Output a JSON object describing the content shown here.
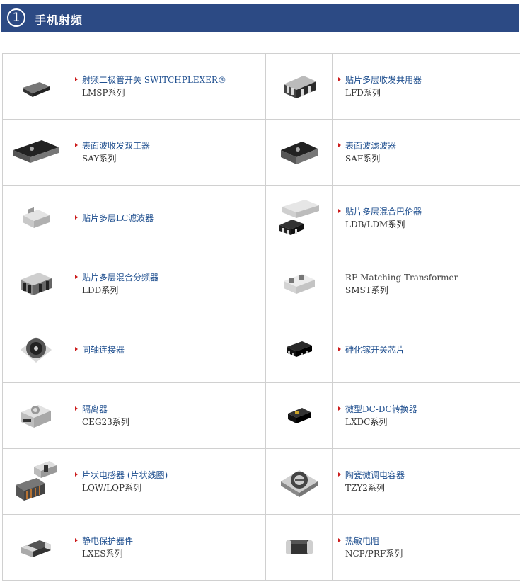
{
  "header": {
    "number": "1",
    "title": "手机射频"
  },
  "products": [
    {
      "icon": "chip-icon",
      "name": "射频二极管开关 SWITCHPLEXER®",
      "series": "LMSP系列",
      "link": true
    },
    {
      "icon": "chip-icon",
      "name": "贴片多层收发共用器",
      "series": "LFD系列",
      "link": true
    },
    {
      "icon": "saw-chip-icon",
      "name": "表面波收发双工器",
      "series": "SAY系列",
      "link": true
    },
    {
      "icon": "saw-chip-icon",
      "name": "表面波滤波器",
      "series": "SAF系列",
      "link": true
    },
    {
      "icon": "chip-icon",
      "name": "贴片多层LC滤波器",
      "series": "",
      "link": true
    },
    {
      "icon": "chip-icon",
      "name": "贴片多层混合巴伦器",
      "series": "LDB/LDM系列",
      "link": true
    },
    {
      "icon": "chip-icon",
      "name": "贴片多层混合分频器",
      "series": "LDD系列",
      "link": true
    },
    {
      "icon": "chip-icon",
      "name": "RF Matching Transformer",
      "series": "SMST系列",
      "link": false
    },
    {
      "icon": "connector-icon",
      "name": "同轴连接器",
      "series": "",
      "link": true
    },
    {
      "icon": "chip-icon",
      "name": "砷化镓开关芯片",
      "series": "",
      "link": true
    },
    {
      "icon": "isolator-icon",
      "name": "隔离器",
      "series": "CEG23系列",
      "link": true
    },
    {
      "icon": "chip-icon",
      "name": "微型DC-DC转换器",
      "series": "LXDC系列",
      "link": true
    },
    {
      "icon": "inductor-icon",
      "name": "片状电感器 (片状线圈)",
      "series": "LQW/LQP系列",
      "link": true
    },
    {
      "icon": "trimmer-icon",
      "name": "陶瓷微调电容器",
      "series": "TZY2系列",
      "link": true
    },
    {
      "icon": "chip-icon",
      "name": "静电保护器件",
      "series": "LXES系列",
      "link": true
    },
    {
      "icon": "chip-icon",
      "name": "热敏电阻",
      "series": "NCP/PRF系列",
      "link": true
    }
  ]
}
